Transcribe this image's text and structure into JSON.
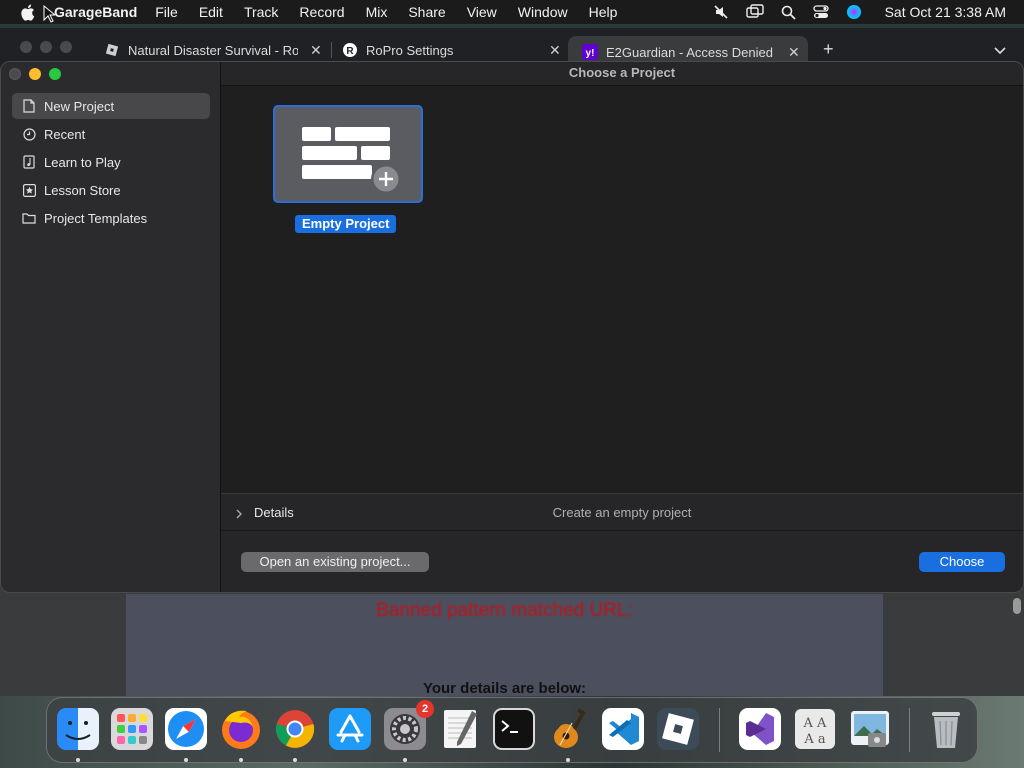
{
  "menubar": {
    "app": "GarageBand",
    "items": [
      "File",
      "Edit",
      "Track",
      "Record",
      "Mix",
      "Share",
      "View",
      "Window",
      "Help"
    ],
    "clock": "Sat Oct 21  3:38 AM",
    "status_icons": [
      "mute-icon",
      "screen-mirror-icon",
      "search-icon",
      "control-center-icon",
      "siri-icon"
    ]
  },
  "browser": {
    "tabs": [
      {
        "title": "Natural Disaster Survival - Rol",
        "icon": "roblox-icon"
      },
      {
        "title": "RoPro Settings",
        "icon": "ropro-icon"
      },
      {
        "title": "E2Guardian - Access Denied",
        "icon": "yahoo-icon"
      }
    ],
    "page": {
      "error_text": "Banned pattern matched URL:",
      "details_text": "Your details are below:"
    }
  },
  "garageband": {
    "window_title": "Choose a Project",
    "sidebar": [
      {
        "label": "New Project",
        "icon": "document-icon",
        "selected": true
      },
      {
        "label": "Recent",
        "icon": "clock-icon",
        "selected": false
      },
      {
        "label": "Learn to Play",
        "icon": "music-note-icon",
        "selected": false
      },
      {
        "label": "Lesson Store",
        "icon": "star-icon",
        "selected": false
      },
      {
        "label": "Project Templates",
        "icon": "folder-icon",
        "selected": false
      }
    ],
    "project": {
      "label": "Empty Project"
    },
    "details": {
      "label": "Details",
      "description": "Create an empty project"
    },
    "footer": {
      "open_label": "Open an existing project...",
      "choose_label": "Choose"
    }
  },
  "dock": {
    "apps": [
      {
        "name": "Finder",
        "icon": "finder-icon",
        "running": true
      },
      {
        "name": "Launchpad",
        "icon": "launchpad-icon",
        "running": false
      },
      {
        "name": "Safari",
        "icon": "safari-icon",
        "running": true
      },
      {
        "name": "Firefox",
        "icon": "firefox-icon",
        "running": true
      },
      {
        "name": "Chrome",
        "icon": "chrome-icon",
        "running": true
      },
      {
        "name": "App Store",
        "icon": "app-store-icon",
        "running": false
      },
      {
        "name": "System Settings",
        "icon": "settings-icon",
        "running": true,
        "badge": "2"
      },
      {
        "name": "TextEdit",
        "icon": "textedit-icon",
        "running": false
      },
      {
        "name": "Terminal",
        "icon": "terminal-icon",
        "running": false
      },
      {
        "name": "GarageBand",
        "icon": "garageband-icon",
        "running": true
      },
      {
        "name": "VS Code",
        "icon": "vscode-icon",
        "running": false
      },
      {
        "name": "Roblox",
        "icon": "roblox-icon",
        "running": false
      },
      {
        "name": "Visual Studio",
        "icon": "visual-studio-icon",
        "running": false
      },
      {
        "name": "Font Book",
        "icon": "font-book-icon",
        "running": false
      },
      {
        "name": "Preview",
        "icon": "preview-icon",
        "running": false
      },
      {
        "name": "Trash",
        "icon": "trash-icon",
        "running": false
      }
    ]
  },
  "colors": {
    "accent": "#1a6fe0",
    "window_bg": "#232324",
    "sidebar_bg": "#2b2b2d"
  }
}
